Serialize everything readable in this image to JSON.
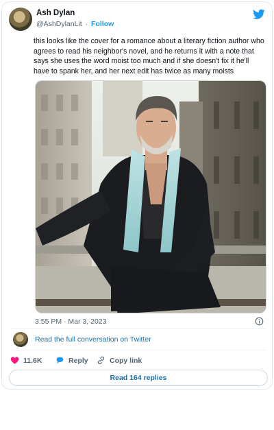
{
  "author": {
    "name": "Ash Dylan",
    "handle": "@AshDylanLit",
    "separator": "·",
    "follow_label": "Follow"
  },
  "tweet": {
    "text": "this looks like the cover for a romance about a literary fiction author who agrees to read his neighbor's novel, and he returns it with a note that says she uses the word moist too much and if she doesn't fix it he'll have to spank her, and her next edit has twice as many moists",
    "timestamp": "3:55 PM · Mar 3, 2023"
  },
  "conversation": {
    "link_label": "Read the full conversation on Twitter"
  },
  "actions": {
    "likes_count": "11.6K",
    "reply_label": "Reply",
    "copy_label": "Copy link"
  },
  "replies_button": {
    "label": "Read 164 replies"
  },
  "colors": {
    "twitter_blue": "#1d9bf0",
    "link_blue": "#1d6fa5",
    "heart_pink": "#f91880",
    "muted_text": "#536471"
  },
  "icons": [
    "twitter-bird-icon",
    "info-icon",
    "heart-icon",
    "reply-bubble-icon",
    "link-icon"
  ]
}
